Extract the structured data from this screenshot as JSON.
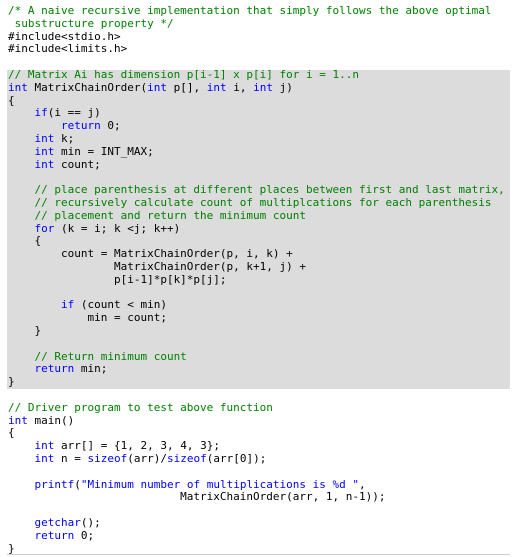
{
  "editor": {
    "lines": [
      [
        {
          "t": "/* A naive recursive implementation that simply follows the above optimal",
          "c": "c"
        }
      ],
      [
        {
          "t": " substructure property */",
          "c": "c"
        }
      ],
      [
        {
          "t": "#include<stdio.h>",
          "c": ""
        }
      ],
      [
        {
          "t": "#include<limits.h>",
          "c": ""
        }
      ],
      [
        {
          "t": "",
          "c": ""
        }
      ],
      [
        {
          "t": "// Matrix Ai has dimension p[i-1] x p[i] for i = 1..n",
          "c": "c"
        }
      ],
      [
        {
          "t": "int",
          "c": "k"
        },
        {
          "t": " MatrixChainOrder(",
          "c": ""
        },
        {
          "t": "int",
          "c": "k"
        },
        {
          "t": " p[], ",
          "c": ""
        },
        {
          "t": "int",
          "c": "k"
        },
        {
          "t": " i, ",
          "c": ""
        },
        {
          "t": "int",
          "c": "k"
        },
        {
          "t": " j)",
          "c": ""
        }
      ],
      [
        {
          "t": "{",
          "c": ""
        }
      ],
      [
        {
          "t": "    ",
          "c": ""
        },
        {
          "t": "if",
          "c": "k"
        },
        {
          "t": "(i == j)",
          "c": ""
        }
      ],
      [
        {
          "t": "        ",
          "c": ""
        },
        {
          "t": "return",
          "c": "k"
        },
        {
          "t": " 0;",
          "c": ""
        }
      ],
      [
        {
          "t": "    ",
          "c": ""
        },
        {
          "t": "int",
          "c": "k"
        },
        {
          "t": " k;",
          "c": ""
        }
      ],
      [
        {
          "t": "    ",
          "c": ""
        },
        {
          "t": "int",
          "c": "k"
        },
        {
          "t": " min = INT_MAX;",
          "c": ""
        }
      ],
      [
        {
          "t": "    ",
          "c": ""
        },
        {
          "t": "int",
          "c": "k"
        },
        {
          "t": " count;",
          "c": ""
        }
      ],
      [
        {
          "t": "",
          "c": ""
        }
      ],
      [
        {
          "t": "    // place parenthesis at different places between first and last matrix,",
          "c": "c"
        }
      ],
      [
        {
          "t": "    // recursively calculate count of multiplcations for each parenthesis",
          "c": "c"
        }
      ],
      [
        {
          "t": "    // placement and return the minimum count",
          "c": "c"
        }
      ],
      [
        {
          "t": "    ",
          "c": ""
        },
        {
          "t": "for",
          "c": "k"
        },
        {
          "t": " (k = i; k <j; k++)",
          "c": ""
        }
      ],
      [
        {
          "t": "    {",
          "c": ""
        }
      ],
      [
        {
          "t": "        count = MatrixChainOrder(p, i, k) +",
          "c": ""
        }
      ],
      [
        {
          "t": "                MatrixChainOrder(p, k+1, j) +",
          "c": ""
        }
      ],
      [
        {
          "t": "                p[i-1]*p[k]*p[j];",
          "c": ""
        }
      ],
      [
        {
          "t": "",
          "c": ""
        }
      ],
      [
        {
          "t": "        ",
          "c": ""
        },
        {
          "t": "if",
          "c": "k"
        },
        {
          "t": " (count < min)",
          "c": ""
        }
      ],
      [
        {
          "t": "            min = count;",
          "c": ""
        }
      ],
      [
        {
          "t": "    }",
          "c": ""
        }
      ],
      [
        {
          "t": "",
          "c": ""
        }
      ],
      [
        {
          "t": "    // Return minimum count",
          "c": "c"
        }
      ],
      [
        {
          "t": "    ",
          "c": ""
        },
        {
          "t": "return",
          "c": "k"
        },
        {
          "t": " min;",
          "c": ""
        }
      ],
      [
        {
          "t": "}",
          "c": ""
        }
      ],
      [
        {
          "t": "",
          "c": ""
        }
      ],
      [
        {
          "t": "// Driver program to test above function",
          "c": "c"
        }
      ],
      [
        {
          "t": "int",
          "c": "k"
        },
        {
          "t": " main()",
          "c": ""
        }
      ],
      [
        {
          "t": "{",
          "c": ""
        }
      ],
      [
        {
          "t": "    ",
          "c": ""
        },
        {
          "t": "int",
          "c": "k"
        },
        {
          "t": " arr[] = {1, 2, 3, 4, 3};",
          "c": ""
        }
      ],
      [
        {
          "t": "    ",
          "c": ""
        },
        {
          "t": "int",
          "c": "k"
        },
        {
          "t": " n = ",
          "c": ""
        },
        {
          "t": "sizeof",
          "c": "k"
        },
        {
          "t": "(arr)/",
          "c": ""
        },
        {
          "t": "sizeof",
          "c": "k"
        },
        {
          "t": "(arr[0]);",
          "c": ""
        }
      ],
      [
        {
          "t": "",
          "c": ""
        }
      ],
      [
        {
          "t": "    ",
          "c": ""
        },
        {
          "t": "printf",
          "c": "k"
        },
        {
          "t": "(",
          "c": ""
        },
        {
          "t": "\"Minimum number of multiplications is %d \"",
          "c": "k"
        },
        {
          "t": ",",
          "c": ""
        }
      ],
      [
        {
          "t": "                          MatrixChainOrder(arr, 1, n-1));",
          "c": ""
        }
      ],
      [
        {
          "t": "",
          "c": ""
        }
      ],
      [
        {
          "t": "    ",
          "c": ""
        },
        {
          "t": "getchar",
          "c": "k"
        },
        {
          "t": "();",
          "c": ""
        }
      ],
      [
        {
          "t": "    ",
          "c": ""
        },
        {
          "t": "return",
          "c": "k"
        },
        {
          "t": " 0;",
          "c": ""
        }
      ],
      [
        {
          "t": "}",
          "c": ""
        }
      ]
    ]
  },
  "colors": {
    "comment": "#008000",
    "keyword": "#0000ff",
    "text": "#000000",
    "highlight": "#dcdcdc"
  }
}
